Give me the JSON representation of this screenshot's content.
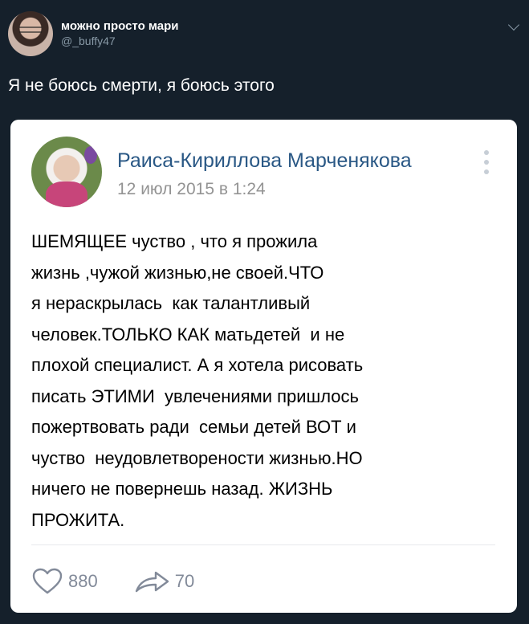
{
  "tweet": {
    "display_name": "можно просто мари",
    "handle": "@_buffy47",
    "text": "Я не боюсь смерти, я боюсь этого",
    "icons": [
      "avatar",
      "chevron-down-icon"
    ]
  },
  "embedded_post": {
    "author": "Раиса-Кириллова Марченякова",
    "date": "12 июл 2015 в 1:24",
    "body_lines": [
      "ШЕМЯЩЕЕ чуство , что я прожила",
      "жизнь ,чужой жизнью,не своей.ЧТО",
      "я нераскрылась  как талантливый",
      "человек.ТОЛЬКО КАК матьдетей  и не",
      "плохой специалист. А я хотела рисовать",
      "писать ЭТИМИ  увлечениями пришлось",
      "пожертвовать ради  семьи детей ВОТ и",
      "чуство  неудовлетворености жизнью.НО",
      "ничего не повернешь назад. ЖИЗНЬ",
      "ПРОЖИТА."
    ],
    "likes": "880",
    "shares": "70",
    "icons": [
      "heart-icon",
      "share-arrow-icon",
      "more-dots-icon"
    ]
  }
}
